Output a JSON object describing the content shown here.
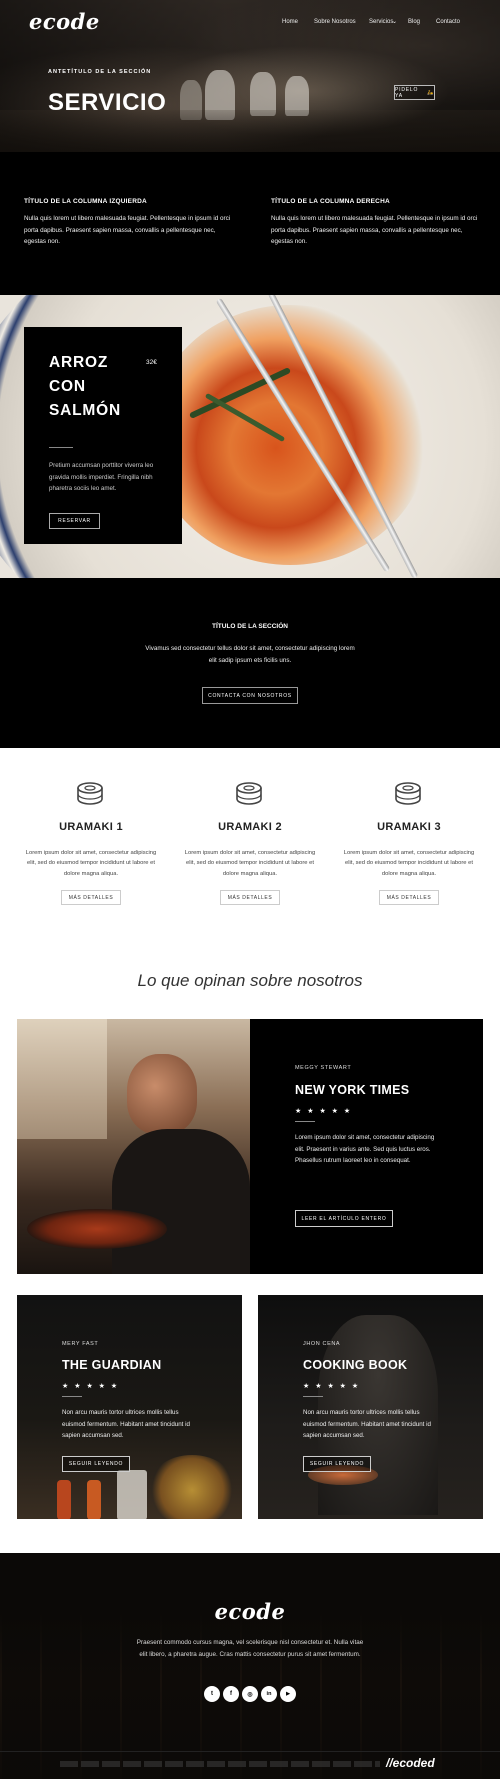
{
  "header": {
    "logo": "ecode",
    "nav": [
      "Home",
      "Sobre Nosotros",
      "Servicios",
      "Blog",
      "Contacto"
    ],
    "dropdown_caret": "⌄"
  },
  "hero": {
    "kicker": "ANTETÍTULO DE LA SECCIÓN",
    "title": "SERVICIO",
    "button": "PIDELO YA"
  },
  "columns": {
    "left_title": "TÍTULO DE LA COLUMNA IZQUIERDA",
    "left_text": "Nulla quis lorem ut libero malesuada feugiat. Pellentesque in ipsum id orci porta dapibus. Praesent sapien massa, convallis a pellentesque nec, egestas non.",
    "right_title": "TÍTULO DE LA COLUMNA DERECHA",
    "right_text": "Nulla quis lorem ut libero malesuada feugiat. Pellentesque in ipsum id orci porta dapibus. Praesent sapien massa, convallis a pellentesque nec, egestas non."
  },
  "dish": {
    "title_line1": "ARROZ",
    "title_line2": "CON",
    "title_line3": "SALMÓN",
    "price": "32€",
    "text": "Pretium accumsan porttitor viverra leo gravida mollis imperdiet. Fringilla nibh pharetra sociis leo amet.",
    "button": "RESERVAR"
  },
  "section": {
    "title": "TÍTULO DE LA SECCIÓN",
    "text": "Vivamus sed consectetur tellus dolor sit amet, consectetur adipiscing lorem elit sadip ipsum ets ficilis uns.",
    "button": "CONTACTA CON NOSOTROS"
  },
  "uramaki": [
    {
      "title": "URAMAKI 1",
      "text": "Lorem ipsum dolor sit amet, consectetur adipiscing elit, sed do eiusmod tempor incididunt ut labore et dolore magna aliqua.",
      "button": "MÁS DETALLES"
    },
    {
      "title": "URAMAKI 2",
      "text": "Lorem ipsum dolor sit amet, consectetur adipiscing elit, sed do eiusmod tempor incididunt ut labore et dolore magna aliqua.",
      "button": "MÁS DETALLES"
    },
    {
      "title": "URAMAKI 3",
      "text": "Lorem ipsum dolor sit amet, consectetur adipiscing elit, sed do eiusmod tempor incididunt ut labore et dolore magna aliqua.",
      "button": "MÁS DETALLES"
    }
  ],
  "testimonials": {
    "heading": "Lo que opinan sobre nosotros",
    "featured": {
      "name": "MEGGY STEWART",
      "title": "NEW YORK TIMES",
      "stars": "★ ★ ★ ★ ★",
      "text": "Lorem ipsum dolor sit amet, consectetur adipiscing elit. Praesent in varius ante. Sed quis luctus eros. Phasellus rutrum laoreet leo in consequat.",
      "button": "LEER EL ARTÍCULO ENTERO"
    },
    "cards": [
      {
        "name": "MERY FAST",
        "title": "THE GUARDIAN",
        "stars": "★ ★ ★ ★ ★",
        "text": "Non arcu mauris tortor ultrices mollis tellus euismod fermentum. Habitant amet tincidunt id sapien accumsan sed.",
        "button": "SEGUIR LEYENDO"
      },
      {
        "name": "JHON CENA",
        "title": "COOKING BOOK",
        "stars": "★ ★ ★ ★ ★",
        "text": "Non arcu mauris tortor ultrices mollis tellus euismod fermentum. Habitant amet tincidunt id sapien accumsan sed.",
        "button": "SEGUIR LEYENDO"
      }
    ]
  },
  "footer": {
    "logo": "ecode",
    "text": "Praesent commodo cursus magna, vel scelerisque nisl consectetur et. Nulla vitae elit libero, a pharetra augue. Cras mattis consectetur purus sit amet fermentum.",
    "social": [
      "t",
      "f",
      "◎",
      "in",
      "▶"
    ],
    "brand": "//ecoded"
  }
}
